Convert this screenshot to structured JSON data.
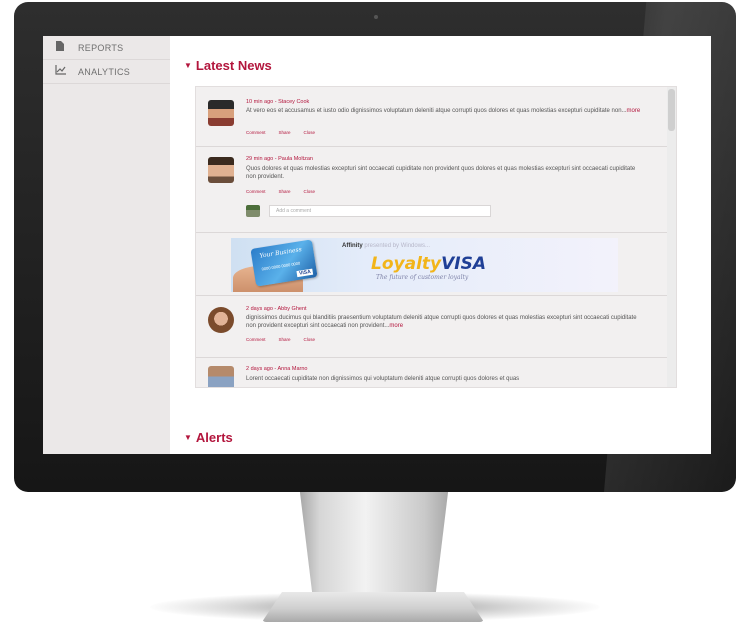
{
  "sidebar": {
    "items": [
      {
        "label": "REPORTS",
        "icon": "document-icon"
      },
      {
        "label": "ANALYTICS",
        "icon": "analytics-chart-icon"
      }
    ]
  },
  "sections": {
    "latest_news": "Latest News",
    "alerts": "Alerts"
  },
  "posts": [
    {
      "meta": "10 min ago - Stacey Cook",
      "text": "At vero eos et accusamus et iusto odio dignissimos  voluptatum deleniti atque corrupti quos dolores et quas molestias excepturi  cupiditate non...",
      "more": "more",
      "actions": [
        "Comment",
        "Share",
        "Close"
      ]
    },
    {
      "meta": "29 min ago - Paula Moltzan",
      "text": "Quos dolores et quas molestias excepturi sint occaecati cupiditate non provident quos dolores et quas molestias excepturi sint occaecati cupiditate non provident.",
      "actions": [
        "Comment",
        "Share",
        "Close"
      ],
      "comment_placeholder": "Add a comment"
    },
    {
      "meta": "2 days ago - Abby Ghent",
      "text": "dignissimos ducimus qui blanditiis praesentium voluptatum deleniti atque corrupti quos dolores et quas molestias excepturi sint occaecati cupiditate non provident excepturi sint occaecati non provident...",
      "more": "more",
      "actions": [
        "Comment",
        "Share",
        "Close"
      ]
    },
    {
      "meta": "2 days ago - Anna Marno",
      "text": "Lorent occaecati cupiditate non dignissimos qui voluptatum deleniti atque corrupti quos dolores et quas"
    }
  ],
  "ad": {
    "brand": "Affinity",
    "brand_sub": "presented by Windows...",
    "loyalty": "Loyalty",
    "visa": "VISA",
    "tagline": "The future of customer loyalty",
    "card_script": "Your Business",
    "card_number": "0000 0000 0000 0000",
    "card_visa": "VISA"
  },
  "colors": {
    "accent": "#b3163d",
    "sidebar_bg": "#ebe8e8",
    "panel_bg": "#f2f0f0"
  }
}
